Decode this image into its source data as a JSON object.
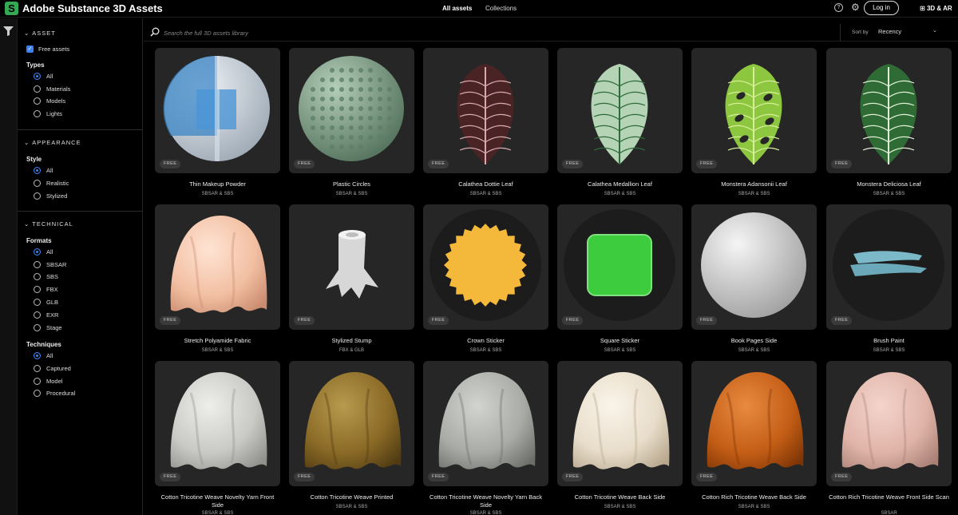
{
  "header": {
    "app_title": "Adobe Substance 3D Assets",
    "tabs": [
      {
        "label": "All assets",
        "active": true
      },
      {
        "label": "Collections",
        "active": false
      }
    ],
    "login_label": "Log in",
    "ar_label": "3D & AR"
  },
  "sidebar": {
    "asset": {
      "heading": "ASSET",
      "free_label": "Free assets",
      "types_label": "Types",
      "types": [
        "All",
        "Materials",
        "Models",
        "Lights"
      ]
    },
    "appearance": {
      "heading": "APPEARANCE",
      "style_label": "Style",
      "styles": [
        "All",
        "Realistic",
        "Stylized"
      ]
    },
    "technical": {
      "heading": "TECHNICAL",
      "formats_label": "Formats",
      "formats": [
        "All",
        "SBSAR",
        "SBS",
        "FBX",
        "GLB",
        "EXR",
        "Stage"
      ],
      "techniques_label": "Techniques",
      "techniques": [
        "All",
        "Captured",
        "Model",
        "Procedural"
      ]
    }
  },
  "search": {
    "placeholder": "Search the full 3D assets library",
    "sort_label": "Sort by",
    "sort_value": "Recency"
  },
  "badge_label": "FREE",
  "assets": [
    {
      "title": "Thin Makeup Powder",
      "formats": "SBSAR & SBS",
      "kind": "powder"
    },
    {
      "title": "Plastic Circles",
      "formats": "SBSAR & SBS",
      "kind": "dots"
    },
    {
      "title": "Calathea Dottie Leaf",
      "formats": "SBSAR & SBS",
      "kind": "leaf-dark"
    },
    {
      "title": "Calathea Medallion Leaf",
      "formats": "SBSAR & SBS",
      "kind": "leaf-light"
    },
    {
      "title": "Monstera Adansonii Leaf",
      "formats": "SBSAR & SBS",
      "kind": "leaf-holes"
    },
    {
      "title": "Monstera Deliciosa Leaf",
      "formats": "SBSAR & SBS",
      "kind": "leaf-split"
    },
    {
      "title": "Stretch Polyamide Fabric",
      "formats": "SBSAR & SBS",
      "kind": "cloth-peach"
    },
    {
      "title": "Stylized Stump",
      "formats": "FBX & GLB",
      "kind": "stump"
    },
    {
      "title": "Crown Sticker",
      "formats": "SBSAR & SBS",
      "kind": "crown"
    },
    {
      "title": "Square Sticker",
      "formats": "SBSAR & SBS",
      "kind": "square"
    },
    {
      "title": "Book Pages Side",
      "formats": "SBSAR & SBS",
      "kind": "sphere-white"
    },
    {
      "title": "Brush Paint",
      "formats": "SBSAR & SBS",
      "kind": "brush"
    },
    {
      "title": "Cotton Tricotine Weave Novelty Yarn Front Side",
      "formats": "SBSAR & SBS",
      "kind": "cloth-grey"
    },
    {
      "title": "Cotton Tricotine Weave Printed",
      "formats": "SBSAR & SBS",
      "kind": "cloth-olive"
    },
    {
      "title": "Cotton Tricotine Weave Novelty Yarn Back Side",
      "formats": "SBSAR & SBS",
      "kind": "cloth-grey2"
    },
    {
      "title": "Cotton Tricotine Weave Back Side",
      "formats": "SBSAR & SBS",
      "kind": "cloth-cream"
    },
    {
      "title": "Cotton Rich Tricotine Weave Back Side",
      "formats": "SBSAR & SBS",
      "kind": "cloth-orange"
    },
    {
      "title": "Cotton Rich Tricotine Weave Front Side Scan",
      "formats": "SBSAR",
      "kind": "cloth-pink"
    }
  ],
  "colors": {
    "accent": "#3b82f6",
    "brand": "#34a853",
    "card_bg": "#262626"
  }
}
